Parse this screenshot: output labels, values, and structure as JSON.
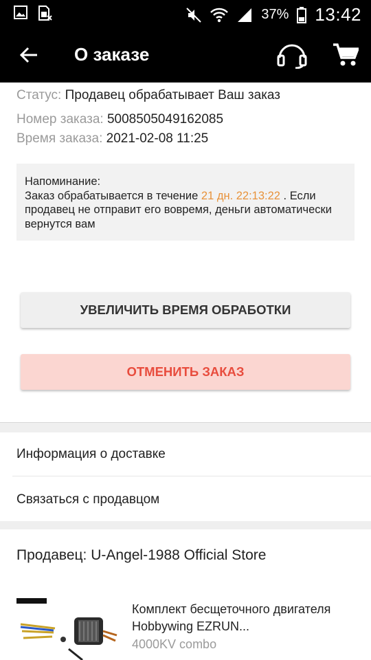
{
  "status_bar": {
    "battery": "37%",
    "time": "13:42"
  },
  "header": {
    "title": "О заказе"
  },
  "order": {
    "status_label": "Статус:",
    "status_value": "Продавец обрабатывает Ваш заказ",
    "number_label": "Номер заказа:",
    "number_value": "5008505049162085",
    "time_label": "Время заказа:",
    "time_value": "2021-02-08 11:25"
  },
  "reminder": {
    "heading": "Напоминание:",
    "text_before": "Заказ обрабатывается в течение ",
    "countdown": "21 дн. 22:13:22",
    "text_after": " . Если продавец не отправит его вовремя, деньги автоматически вернутся вам"
  },
  "buttons": {
    "extend": "УВЕЛИЧИТЬ ВРЕМЯ ОБРАБОТКИ",
    "cancel": "ОТМЕНИТЬ ЗАКАЗ"
  },
  "links": {
    "delivery": "Информация о доставке",
    "contact": "Связаться с продавцом"
  },
  "seller": {
    "label": "Продавец: U-Angel-1988 Official Store"
  },
  "product": {
    "title": "Комплект бесщеточного двигателя Hobbywing EZRUN...",
    "variant": "4000KV combo"
  },
  "colors": {
    "accent": "#e8923a",
    "danger": "#e84c3d",
    "cancel_bg": "#fbd6d1"
  }
}
